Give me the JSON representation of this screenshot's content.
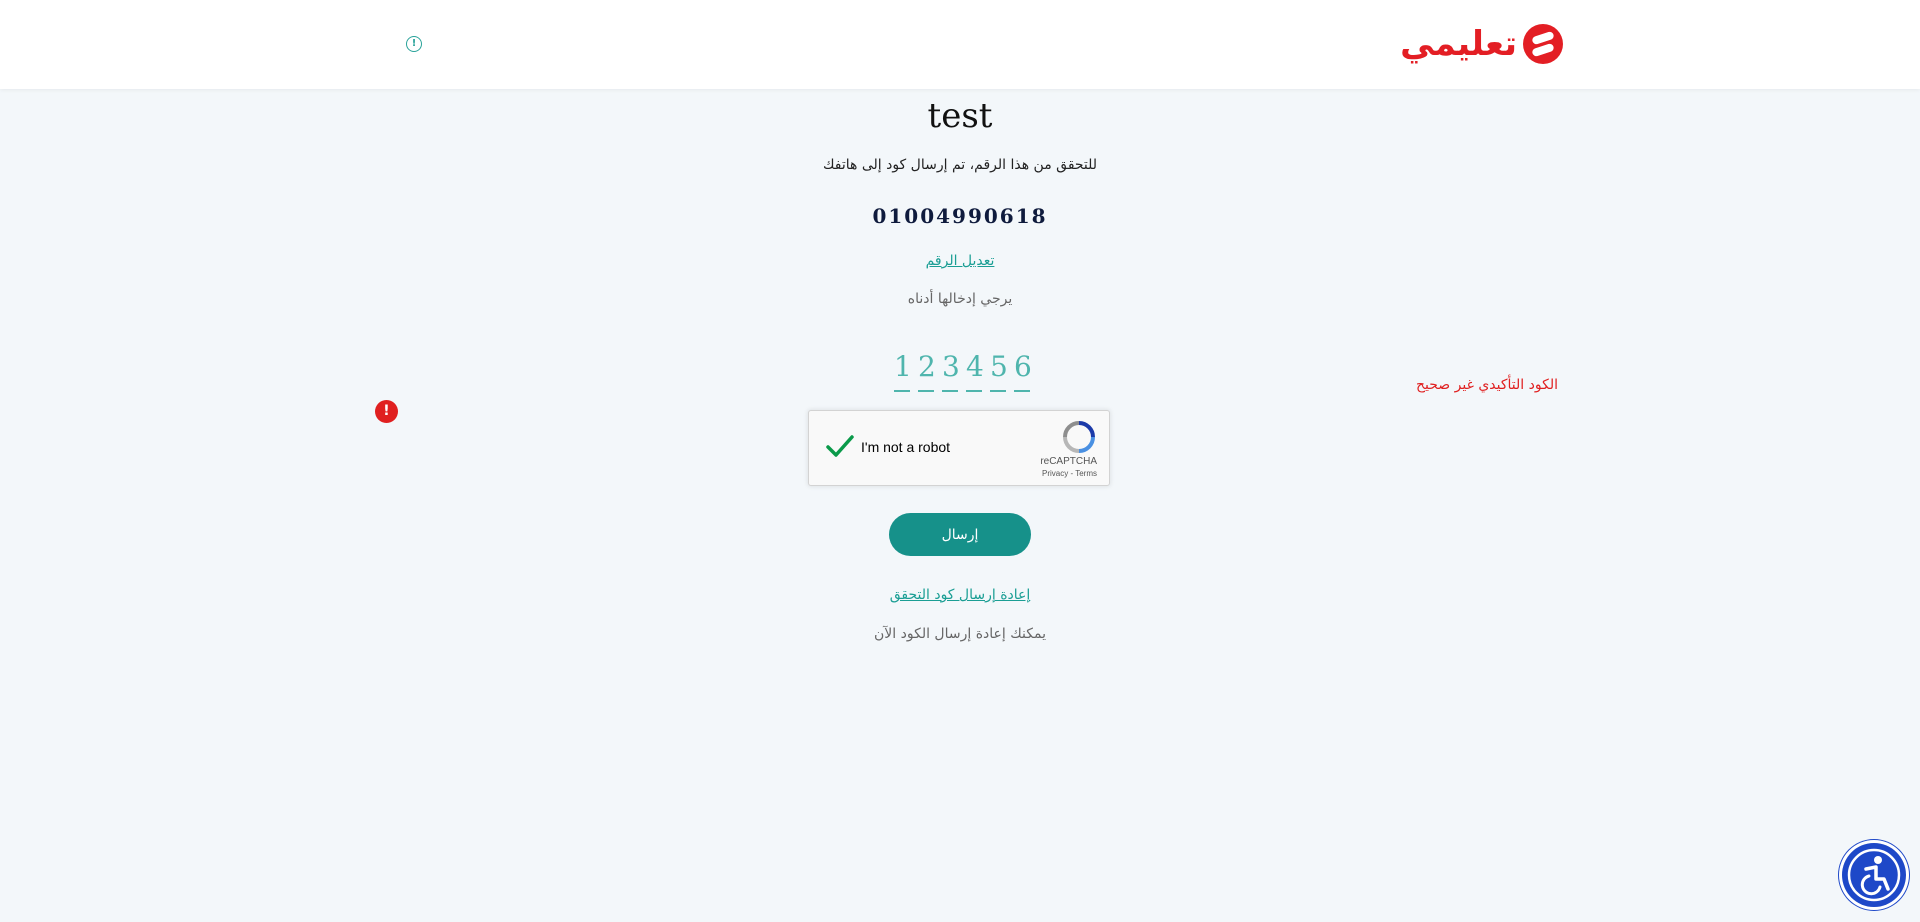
{
  "header": {
    "logo_text": "تعليمي",
    "info_icon": "info-icon"
  },
  "main": {
    "title": "test",
    "subtitle": "للتحقق من هذا الرقم، تم إرسال كود إلى هاتفك",
    "phone": "01004990618",
    "edit_link": "تعديل الرقم",
    "enter_hint": "يرجي إدخالها أدناه",
    "otp_digits": [
      "1",
      "2",
      "3",
      "4",
      "5",
      "6"
    ],
    "error_text": "الكود التأكيدي غير صحيح",
    "error_icon": "!",
    "submit_label": "إرسال",
    "resend_link": "إعادة إرسال كود التحقق",
    "resend_hint": "يمكنك إعادة إرسال الكود الآن"
  },
  "recaptcha": {
    "label": "I'm not a robot",
    "brand": "reCAPTCHA",
    "links": "Privacy - Terms",
    "checked": true
  },
  "colors": {
    "accent": "#16918a",
    "brand_red": "#e31e24",
    "error": "#e02020",
    "a11y_blue": "#1e48c8"
  },
  "icons": {
    "a11y": "accessibility-icon"
  }
}
